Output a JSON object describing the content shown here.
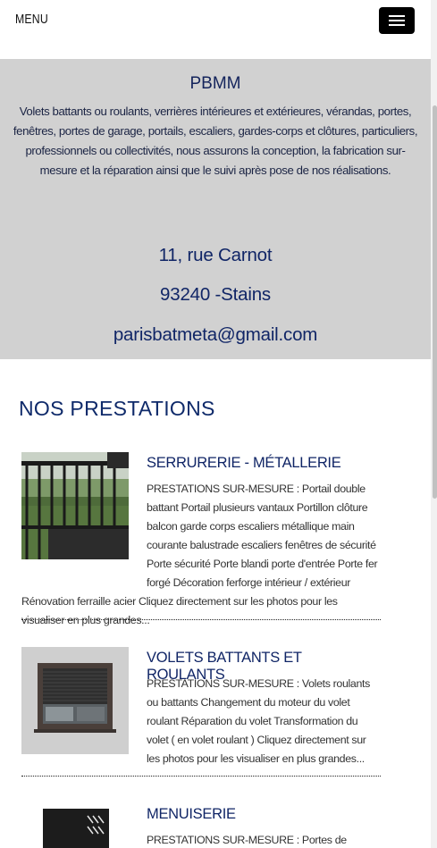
{
  "header": {
    "menu_label": "MENU"
  },
  "hero": {
    "title": "PBMM",
    "description": "Volets battants ou roulants, verrières intérieures et extérieures, vérandas, portes, fenêtres, portes de garage, portails, escaliers, gardes-corps et clôtures, particuliers, professionnels ou collectivités, nous assurons la conception, la fabrication sur-mesure et la réparation ainsi que le suivi après pose de nos réalisations.",
    "address": "11, rue Carnot",
    "city": "93240 -Stains",
    "email": "parisbatmeta@gmail.com"
  },
  "section": {
    "title": "NOS PRESTATIONS"
  },
  "services": [
    {
      "title": "SERRURERIE - MÉTALLERIE",
      "text": "PRESTATIONS SUR-MESURE :   Portail double battant Portail plusieurs vantaux Portillon clôture balcon garde corps escaliers métallique main courante balustrade escaliers fenêtres de sécurité Porte sécurité Porte blandi porte d'entrée Porte fer forgé Décoration ferforge intérieur / extérieur Rénovation ferraille acier Cliquez directement sur les photos pour les visualiser en plus grandes..."
    },
    {
      "title": "VOLETS BATTANTS ET ROULANTS",
      "text": "PRESTATIONS SUR-MESURE :   Volets roulants ou battants Changement du moteur du volet roulant Réparation du volet Transformation du volet ( en volet roulant ) Cliquez directement sur les photos pour les visualiser en plus grandes..."
    },
    {
      "title": "MENUISERIE",
      "text": "PRESTATIONS SUR-MESURE :   Portes de garage"
    }
  ]
}
